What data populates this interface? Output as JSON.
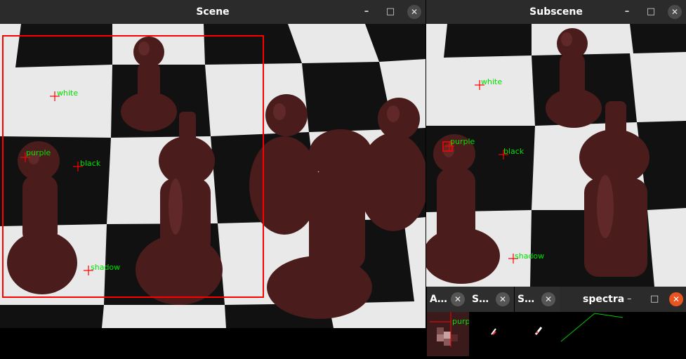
{
  "scene_window": {
    "title": "Scene",
    "min": "–",
    "max": "□",
    "close": "✕"
  },
  "subscene_window": {
    "title": "Subscene",
    "min": "–",
    "max": "□",
    "close": "✕"
  },
  "markers": {
    "white": "white",
    "purple": "purple",
    "black": "black",
    "shadow": "shadow"
  },
  "small_windows": [
    {
      "title": "A…",
      "close": "✕"
    },
    {
      "title": "S…",
      "close": "✕"
    },
    {
      "title": "S…",
      "close": "✕"
    }
  ],
  "spectra_window": {
    "title": "spectra",
    "min": "–",
    "max": "□",
    "close": "✕"
  },
  "zoom_label": "purp",
  "colors": {
    "titlebar": "#2b2b2b",
    "marker": "#ff0000",
    "label": "#00e000",
    "close_active": "#e95420"
  }
}
